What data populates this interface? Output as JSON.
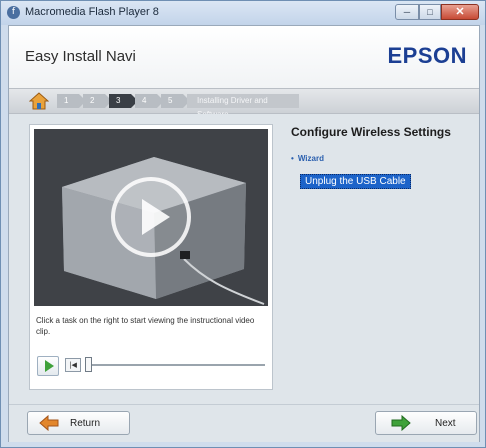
{
  "window": {
    "title": "Macromedia Flash Player 8",
    "controls": {
      "minimize": "─",
      "maximize": "□",
      "close": "✕"
    }
  },
  "header": {
    "title": "Easy Install Navi",
    "brand": "EPSON"
  },
  "steps": {
    "items": [
      "1",
      "2",
      "3",
      "4",
      "5"
    ],
    "active_index": 2,
    "current_label": "Installing Driver and Software"
  },
  "video": {
    "caption": "Click a task on the right to start viewing the instructional video clip.",
    "rewind_icon": "|◀",
    "progress": 0.0
  },
  "tasks": {
    "title": "Configure Wireless Settings",
    "section_bullet": "•",
    "section": "Wizard",
    "items": [
      "Unplug the USB Cable"
    ]
  },
  "footer": {
    "return_label": "Return",
    "next_label": "Next"
  },
  "colors": {
    "brand": "#1c3f93",
    "selection": "#1c63c9",
    "next_arrow": "#3fa13a",
    "return_arrow": "#e2862c"
  }
}
